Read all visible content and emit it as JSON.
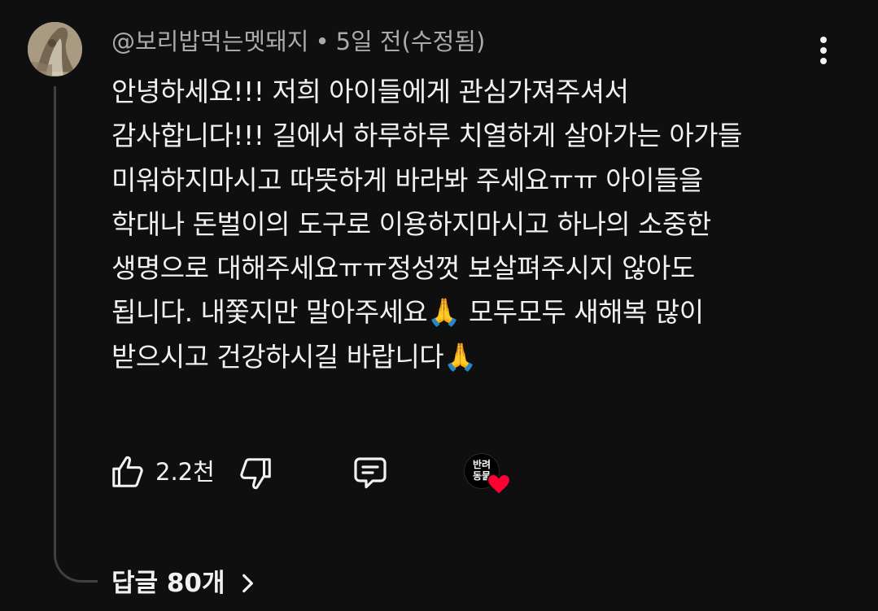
{
  "comment": {
    "author": "@보리밥먹는멧돼지",
    "separator": "•",
    "time": "5일 전(수정됨)",
    "lines": [
      "안녕하세요!!! 저희 아이들에게 관심가져주셔서",
      "감사합니다!!! 길에서 하루하루 치열하게 살아가는 아가들",
      "미워하지마시고 따뜻하게 바라봐 주세요ㅠㅠ 아이들을",
      "학대나 돈벌이의 도구로 이용하지마시고 하나의 소중한",
      "생명으로 대해주세요ㅠㅠ정성껏 보살펴주시지 않아도",
      "됩니다. 내쫓지만 말아주세요🙏 모두모두 새해복 많이",
      "받으시고 건강하시길 바랍니다🙏"
    ]
  },
  "actions": {
    "like_count": "2.2천",
    "like_icon": "thumbs-up-icon",
    "dislike_icon": "thumbs-down-icon",
    "reply_icon": "comment-icon",
    "creator_heart": {
      "avatar_text_line1": "반려",
      "avatar_text_line2": "동물",
      "heart_color": "#ff0033"
    }
  },
  "replies": {
    "label": "답글 80개"
  },
  "colors": {
    "background": "#0f0f0f",
    "text_primary": "#f1f1f1",
    "text_secondary": "#aaaaaa",
    "thread_line": "#3f3f3f"
  }
}
